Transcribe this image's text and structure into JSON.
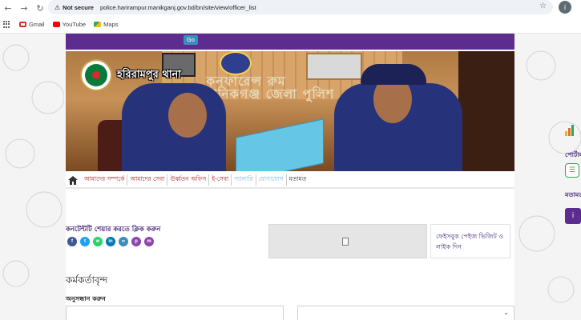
{
  "browser": {
    "nav": {
      "back": "←",
      "forward": "→",
      "reload": "↻"
    },
    "warning_icon": "⚠",
    "security_label": "Not secure",
    "url": "police.harirampur.manikganj.gov.bd/bn/site/view/officer_list",
    "star_icon": "☆",
    "profile_letter": "i",
    "bookmarks": [
      {
        "label": "Gmail",
        "icon": "gmail-icon",
        "color": "#d93025"
      },
      {
        "label": "YouTube",
        "icon": "youtube-icon",
        "color": "#ff0000"
      },
      {
        "label": "Maps",
        "icon": "maps-icon",
        "color": "#34a853"
      }
    ]
  },
  "site": {
    "top_button": "Go",
    "banner": {
      "thana_name": "হরিরামপুর থানা",
      "sign_text": "কনফারেন্স রুম মানিকগঞ্জ জেলা পুলিশ"
    },
    "menu": {
      "home_icon": "⌂",
      "items": [
        {
          "label": "আমাদের সম্পর্কে",
          "color": "#b0282d"
        },
        {
          "label": "আমাদের সেবা",
          "color": "#b0282d"
        },
        {
          "label": "ঊর্ধ্বতন অফিস",
          "color": "#b0282d"
        },
        {
          "label": "ই-সেবা",
          "color": "#b0282d"
        },
        {
          "label": "গ্যালারি",
          "color": "#7ab8d4"
        },
        {
          "label": "যোগাযোগ",
          "color": "#7ab8d4"
        },
        {
          "label": "মতামত",
          "color": "#333333"
        }
      ]
    },
    "share": {
      "title": "কনটেন্টটি শেয়ার করতে ক্লিক করুন",
      "icons": [
        {
          "name": "facebook-share-icon",
          "glyph": "f",
          "color": "#3b5998"
        },
        {
          "name": "twitter-share-icon",
          "glyph": "t",
          "color": "#1da1f2"
        },
        {
          "name": "whatsapp-share-icon",
          "glyph": "w",
          "color": "#25d366"
        },
        {
          "name": "linkedin-share-icon",
          "glyph": "in",
          "color": "#0077b5"
        },
        {
          "name": "link-share-icon",
          "glyph": "∞",
          "color": "#3c8dbc"
        },
        {
          "name": "print-share-icon",
          "glyph": "p",
          "color": "#8e44ad"
        },
        {
          "name": "messenger-share-icon",
          "glyph": "m",
          "color": "#8e44ad"
        }
      ]
    },
    "facebook_link": "ফেইসবুক পেইজ ভিজিট ও লাইক দিন",
    "officers_title": "কর্মকর্তাবৃন্দ",
    "search_label": "অনুসন্ধান করুন",
    "select_chevron": "⌄",
    "side": {
      "label1": "পোর্টাল",
      "label2": "মতামত",
      "chat_icon": "☰",
      "info_icon": "i"
    }
  }
}
